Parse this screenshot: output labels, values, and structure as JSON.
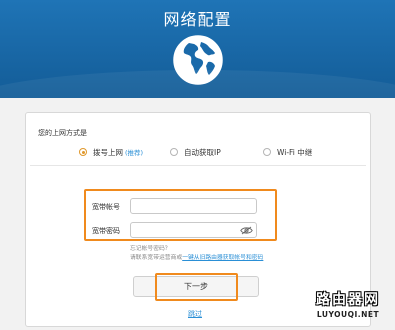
{
  "header": {
    "title": "网络配置"
  },
  "connection": {
    "label": "您的上网方式是",
    "options": [
      {
        "label": "拨号上网",
        "tag": "(推荐)",
        "checked": true
      },
      {
        "label": "自动获取IP",
        "tag": "",
        "checked": false
      },
      {
        "label": "Wi-Fi 中继",
        "tag": "",
        "checked": false
      }
    ]
  },
  "form": {
    "account_label": "宽带帐号",
    "account_value": "",
    "password_label": "宽带密码",
    "password_value": "",
    "hint_line1": "忘记帐号密码？",
    "hint_line2_prefix": "请联系宽带运营商或",
    "hint_line2_link": "一键从旧路由器获取帐号和密码"
  },
  "actions": {
    "next_label": "下一步",
    "skip_label": "跳过"
  },
  "watermark": {
    "cn": "路由器网",
    "en": "LUYOUQI.NET"
  },
  "colors": {
    "header": "#1a6aaa",
    "highlight": "#f08a1d",
    "accent": "#e0982b",
    "link": "#2a8fd6"
  }
}
